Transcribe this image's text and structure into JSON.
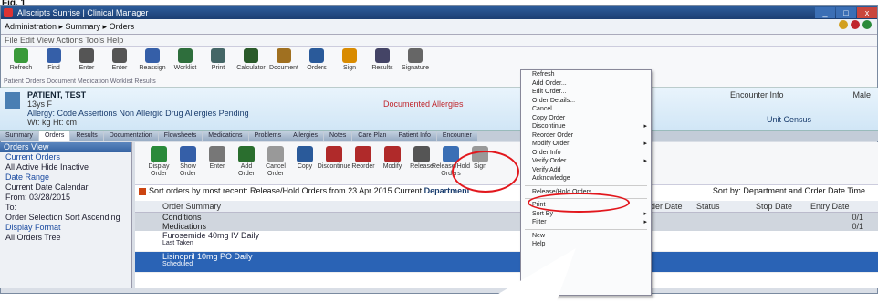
{
  "figure_label": "Fig. 1",
  "window": {
    "title": "Allscripts Sunrise | Clinical Manager",
    "buttons": [
      "_",
      "□",
      "x"
    ]
  },
  "address": {
    "path": "Administration ▸ Summary ▸ Orders"
  },
  "menu": {
    "text": "File  Edit  View  Actions  Tools  Help"
  },
  "toolbar": {
    "items": [
      {
        "label": "Refresh",
        "color": "#3a9a3a"
      },
      {
        "label": "Find",
        "color": "#355fa8"
      },
      {
        "label": "Enter",
        "color": "#555"
      },
      {
        "label": "Enter",
        "color": "#555"
      },
      {
        "label": "Reassign",
        "color": "#355fa8"
      },
      {
        "label": "Worklist",
        "color": "#2e6e3c"
      },
      {
        "label": "Print",
        "color": "#466"
      },
      {
        "label": "Calculator",
        "color": "#2a5a2a"
      },
      {
        "label": "Document",
        "color": "#a07020"
      },
      {
        "label": "Orders",
        "color": "#2a5a9a"
      },
      {
        "label": "Sign",
        "color": "#d98b00"
      },
      {
        "label": "Results",
        "color": "#446"
      },
      {
        "label": "Signature",
        "color": "#666"
      }
    ],
    "caption": "Patient Orders  Document  Medication  Worklist  Results"
  },
  "patient": {
    "name": "PATIENT, TEST",
    "sub": "13ys F",
    "allergy": "Allergy: Code Assertions  Non Allergic  Drug  Allergies Pending",
    "weight": "Wt: kg  Ht: cm",
    "isolation": "Documented Allergies",
    "right1": "Encounter Info",
    "right2": "Male",
    "right3": "Unit Census"
  },
  "tabs": [
    "Summary",
    "Orders",
    "Results",
    "Documentation",
    "Flowsheets",
    "Medications",
    "Problems",
    "Allergies",
    "Notes",
    "Care Plan",
    "Patient Info",
    "Encounter"
  ],
  "left": {
    "header": "Orders View",
    "rows": [
      "Current Orders",
      "All Active  Hide Inactive",
      "Date Range",
      "Current Date  Calendar"
    ],
    "from": "From: 03/28/2015",
    "to": "To:",
    "extra1": "Order Selection  Sort Ascending",
    "extra2": "Display Format",
    "extra3": "All Orders Tree"
  },
  "toolbar2": [
    {
      "label": "Display Order",
      "color": "#2a8a3a"
    },
    {
      "label": "Show Order",
      "color": "#355fa8"
    },
    {
      "label": "Enter",
      "color": "#777"
    },
    {
      "label": "Add Order",
      "color": "#2a6e2e"
    },
    {
      "label": "Cancel Order",
      "color": "#999"
    },
    {
      "label": "Copy",
      "color": "#2a5a9a"
    },
    {
      "label": "Discontinue",
      "color": "#b02a2a"
    },
    {
      "label": "Reorder",
      "color": "#b02a2a"
    },
    {
      "label": "Modify",
      "color": "#b02a2a"
    },
    {
      "label": "Release",
      "color": "#555"
    },
    {
      "label": "Release/Hold Orders",
      "color": "#3a6fb5"
    },
    {
      "label": "Sign",
      "color": "#999"
    }
  ],
  "note": {
    "text": "Sort orders by most recent: Release/Hold Orders from 23 Apr 2015 Current ",
    "bold": "Department",
    "right": "Sort by: Department and Order Date Time"
  },
  "grid": {
    "cols": [
      "Order Summary",
      "Order Date",
      "Status",
      "Stop Date",
      "Entry Date"
    ],
    "sections": [
      {
        "name": "Conditions",
        "count": "0/1"
      },
      {
        "name": "Medications",
        "count": "0/1"
      }
    ],
    "rows": [
      {
        "l1": "Furosemide 40mg IV Daily",
        "l2": "Last Taken",
        "sel": false
      },
      {
        "l1": "Lisinopril 10mg PO Daily",
        "l2": "Scheduled",
        "sel": true
      }
    ]
  },
  "context_menu": [
    {
      "t": "Refresh"
    },
    {
      "t": "Add Order..."
    },
    {
      "t": "Edit Order..."
    },
    {
      "t": "Order Details..."
    },
    {
      "t": "Cancel"
    },
    {
      "t": "Copy Order"
    },
    {
      "t": "Discontinue",
      "ar": true
    },
    {
      "t": "Reorder Order"
    },
    {
      "t": "Modify Order",
      "ar": true
    },
    {
      "t": "Order Info"
    },
    {
      "t": "Verify Order",
      "ar": true
    },
    {
      "t": "Verify Add"
    },
    {
      "t": "Acknowledge"
    },
    {
      "sep": true
    },
    {
      "t": "Release/Hold Orders..."
    },
    {
      "sep": true
    },
    {
      "t": "Print"
    },
    {
      "t": "Sort By",
      "ar": true
    },
    {
      "t": "Filter",
      "ar": true
    },
    {
      "sep": true
    },
    {
      "t": "New"
    },
    {
      "t": "Help"
    }
  ]
}
